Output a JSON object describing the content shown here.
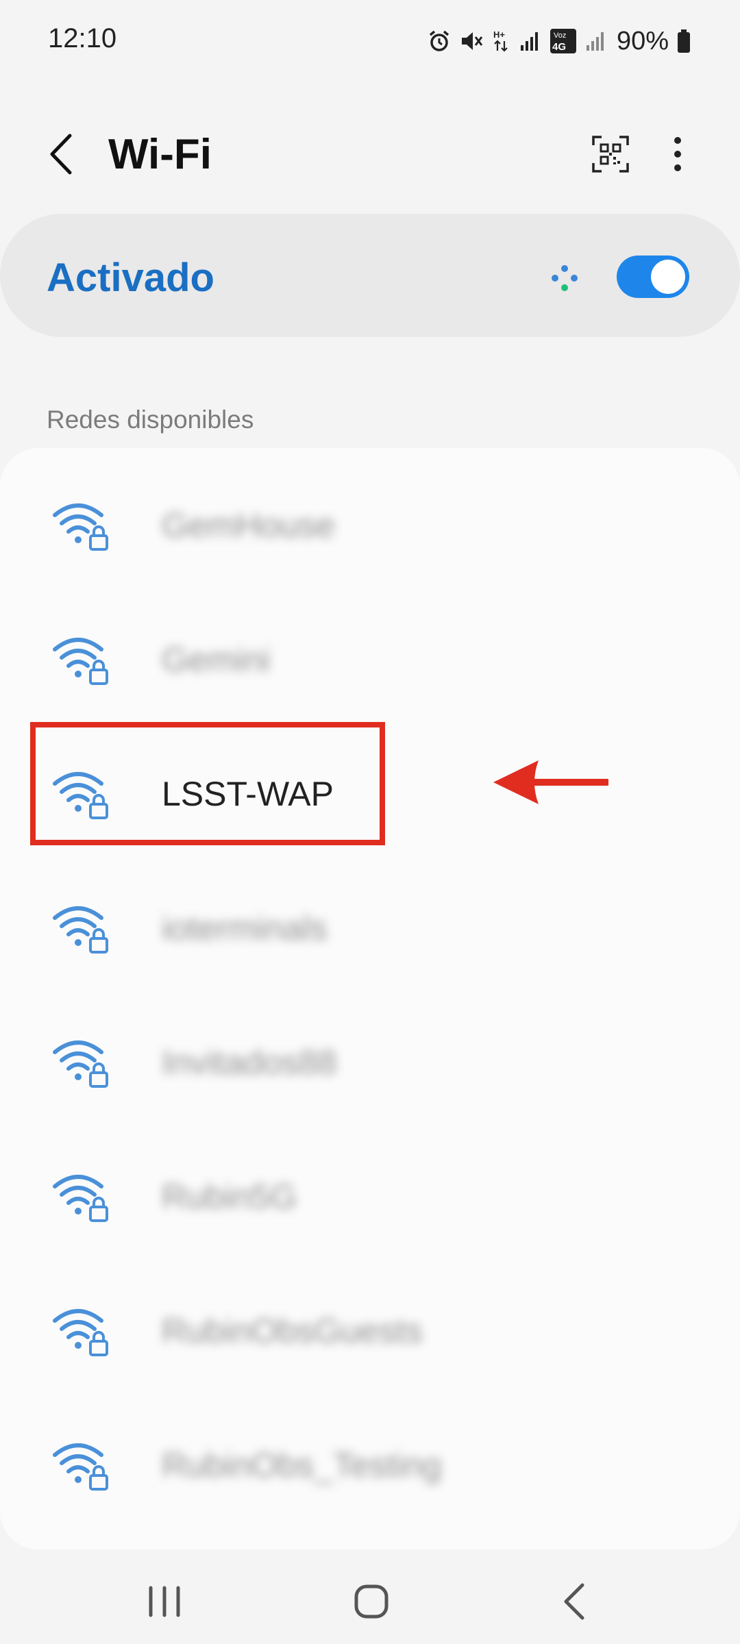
{
  "status_bar": {
    "time": "12:10",
    "battery": "90%",
    "icons": [
      "alarm-icon",
      "mute-icon",
      "data-hplus-icon",
      "signal-icon",
      "volte-4g-icon",
      "signal-icon",
      "battery-icon"
    ]
  },
  "header": {
    "title": "Wi-Fi",
    "icons": [
      "back-arrow-icon",
      "qr-code-icon",
      "more-vert-icon"
    ]
  },
  "wifi_switch": {
    "label": "Activado",
    "state": "on",
    "accent_color": "#1e86ea",
    "label_color": "#1a6fc2"
  },
  "available_networks": {
    "title": "Redes disponibles",
    "items": [
      {
        "name": "GemHouse",
        "blurred": true,
        "secured": true
      },
      {
        "name": "Gemini",
        "blurred": true,
        "secured": true
      },
      {
        "name": "LSST-WAP",
        "blurred": false,
        "secured": true,
        "highlighted": true
      },
      {
        "name": "ioterminals",
        "blurred": true,
        "secured": true
      },
      {
        "name": "Invitados88",
        "blurred": true,
        "secured": true
      },
      {
        "name": "Rubin5G",
        "blurred": true,
        "secured": true
      },
      {
        "name": "RubinObsGuests",
        "blurred": true,
        "secured": true
      },
      {
        "name": "RubinObs_Testing",
        "blurred": true,
        "secured": true
      }
    ]
  },
  "annotation": {
    "color": "#e02d1f",
    "target": "LSST-WAP"
  },
  "nav_bar": {
    "icons": [
      "recent-apps-icon",
      "home-icon",
      "back-icon"
    ]
  }
}
